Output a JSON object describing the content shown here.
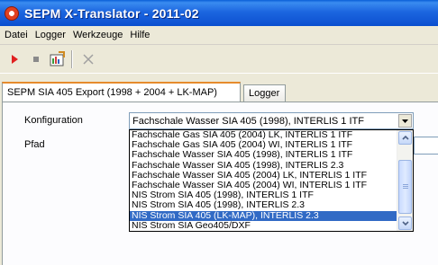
{
  "window": {
    "title": "SEPM X-Translator - 2011-02",
    "icon": "app-logo-icon"
  },
  "menu": [
    "Datei",
    "Logger",
    "Werkzeuge",
    "Hilfe"
  ],
  "toolbar": {
    "buttons": [
      {
        "name": "run-icon",
        "glyph": "▶",
        "color": "#e02020"
      },
      {
        "name": "stop-icon",
        "glyph": "■",
        "color": "#8a8a8a"
      },
      {
        "name": "export-icon",
        "glyph": "",
        "color": "#333333"
      },
      {
        "name": "close-icon",
        "glyph": "✕",
        "color": "#a0a0a0"
      }
    ]
  },
  "tabs": {
    "active": "SEPM SIA 405 Export (1998 + 2004 + LK-MAP)",
    "inactive": "Logger"
  },
  "form": {
    "konfiguration_label": "Konfiguration",
    "pfad_label": "Pfad",
    "konfiguration_value": "Fachschale Wasser SIA 405 (1998), INTERLIS 1 ITF"
  },
  "dropdown": {
    "options": [
      "Fachschale Gas SIA 405 (2004) LK, INTERLIS 1 ITF",
      "Fachschale Gas SIA 405 (2004) WI, INTERLIS 1 ITF",
      "Fachschale Wasser SIA 405 (1998), INTERLIS 1 ITF",
      "Fachschale Wasser SIA 405 (1998), INTERLIS 2.3",
      "Fachschale Wasser SIA 405 (2004) LK, INTERLIS 1 ITF",
      "Fachschale Wasser SIA 405 (2004) WI, INTERLIS 1 ITF",
      "NIS Strom SIA 405 (1998), INTERLIS 1 ITF",
      "NIS Strom SIA 405 (1998), INTERLIS 2.3",
      "NIS Strom SIA 405 (LK-MAP), INTERLIS 2.3",
      "NIS Strom SIA Geo405/DXF"
    ],
    "selected_index": 8
  },
  "colors": {
    "selection": "#316ac5",
    "titlebar": "#0b4fcf"
  }
}
